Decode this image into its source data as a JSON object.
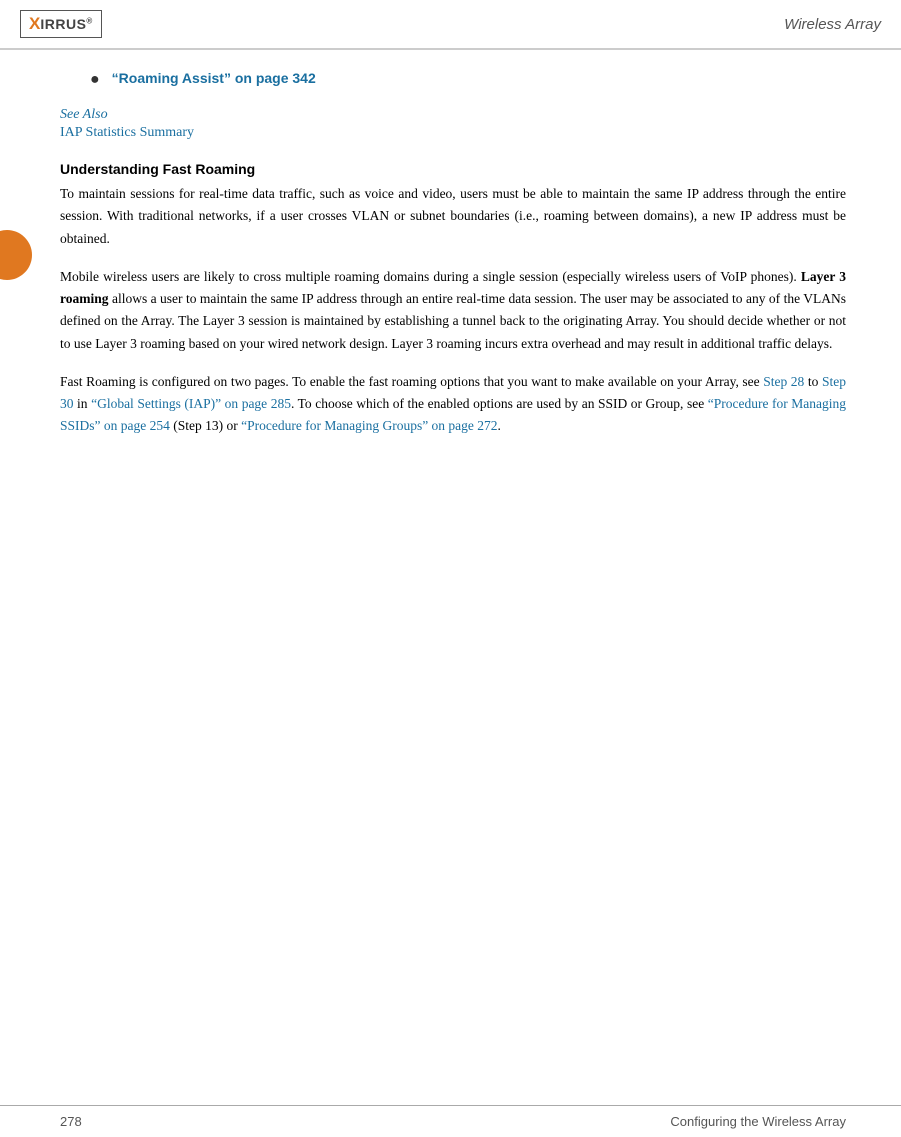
{
  "header": {
    "title": "Wireless Array"
  },
  "footer": {
    "page_number": "278",
    "right_text": "Configuring the Wireless Array"
  },
  "bullet": {
    "link_text": "“Roaming Assist” on page 342"
  },
  "see_also": {
    "label": "See Also",
    "link": "IAP Statistics Summary"
  },
  "sections": {
    "heading": "Understanding Fast Roaming",
    "para1": "To maintain sessions for real-time data traffic, such as voice and video, users must be able to maintain the same IP address through the entire session. With traditional networks, if a user crosses VLAN or subnet boundaries (i.e., roaming between domains), a new IP address must be obtained.",
    "para2_part1": "Mobile wireless users are likely to cross multiple roaming domains during a single session (especially wireless users of VoIP phones). ",
    "para2_bold": "Layer 3 roaming",
    "para2_part2": " allows a user to maintain the same IP address through an entire real-time data session. The user may be associated to any of the VLANs defined on the Array. The Layer 3 session is maintained by establishing a tunnel back to the originating Array. You should decide whether or not to use Layer 3 roaming based on your wired network design. Layer 3 roaming incurs extra overhead and may result in additional traffic delays.",
    "para3_part1": "Fast Roaming is configured on two pages. To enable the fast roaming options that you want to make available on your Array, see ",
    "para3_link1": "Step 28",
    "para3_part2": " to ",
    "para3_link2": "Step 30",
    "para3_part3": " in ",
    "para3_link3": "“Global Settings (IAP)” on page 285",
    "para3_part4": ". To choose which of the enabled options are used by an SSID or Group, see ",
    "para3_link4": "“Procedure for Managing SSIDs” on page 254",
    "para3_part5": " (Step 13) or ",
    "para3_link5": "“Procedure for Managing Groups” on page 272",
    "para3_part6": "."
  }
}
